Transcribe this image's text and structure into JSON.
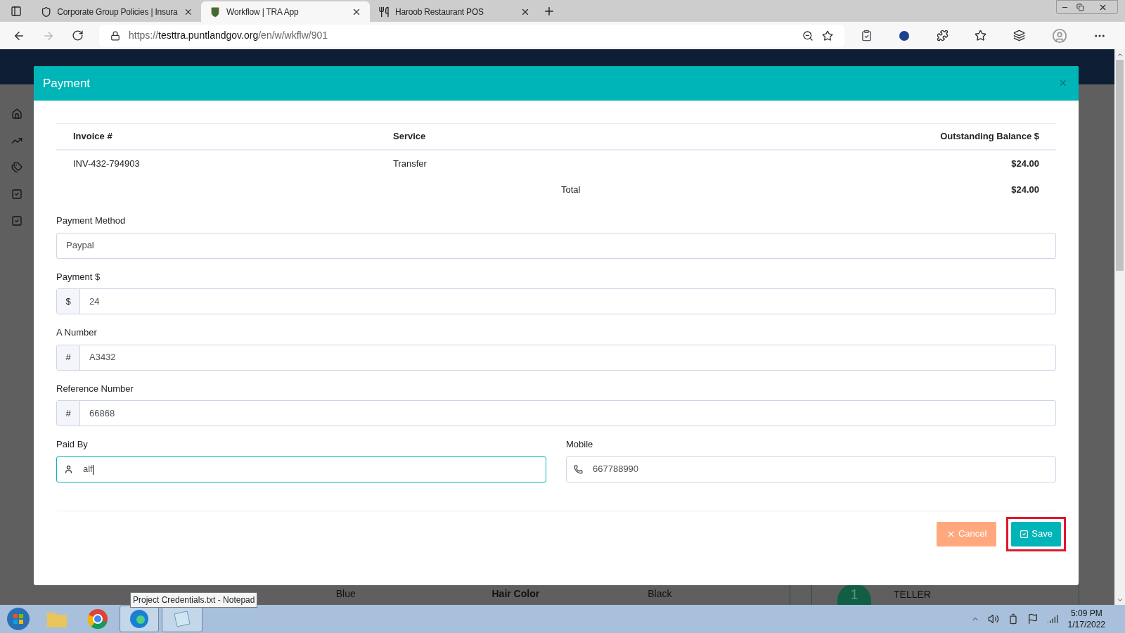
{
  "browser": {
    "tabs": [
      {
        "title": "Corporate Group Policies | Insura",
        "selected": false
      },
      {
        "title": "Workflow | TRA App",
        "selected": true
      },
      {
        "title": "Haroob Restaurant POS",
        "selected": false
      }
    ],
    "url_scheme": "https://",
    "url_host": "testtra.puntlandgov.org",
    "url_path": "/en/w/wkflw/901"
  },
  "modal": {
    "title": "Payment",
    "close": "×",
    "table": {
      "columns": [
        "Invoice #",
        "Service",
        "Outstanding Balance $"
      ],
      "rows": [
        {
          "invoice": "INV-432-794903",
          "service": "Transfer",
          "balance": "$24.00"
        }
      ],
      "total_label": "Total",
      "total": "$24.00"
    },
    "fields": [
      {
        "label": "Payment Method",
        "kind": "select",
        "value": "Paypal"
      },
      {
        "label": "Payment $",
        "kind": "addon",
        "prefix": "$",
        "value": "24"
      },
      {
        "label": "A Number",
        "kind": "addon",
        "prefix": "#",
        "value": "A3432"
      },
      {
        "label": "Reference Number",
        "kind": "addon",
        "prefix": "#",
        "value": "66868"
      }
    ],
    "contact_fields": [
      {
        "label": "Paid By",
        "value": "alf",
        "focused": true
      },
      {
        "label": "Mobile",
        "value": "667788990",
        "focused": false
      }
    ],
    "cancel": "Cancel",
    "save": "Save",
    "save_highlighted": true
  },
  "background": {
    "cells": [
      "Blue",
      "Hair Color",
      "Black"
    ],
    "step": "1",
    "step_label": "TELLER"
  },
  "taskbar": {
    "tooltip": "Project Credentials.txt - Notepad",
    "time": "5:09 PM",
    "date": "1/17/2022"
  }
}
